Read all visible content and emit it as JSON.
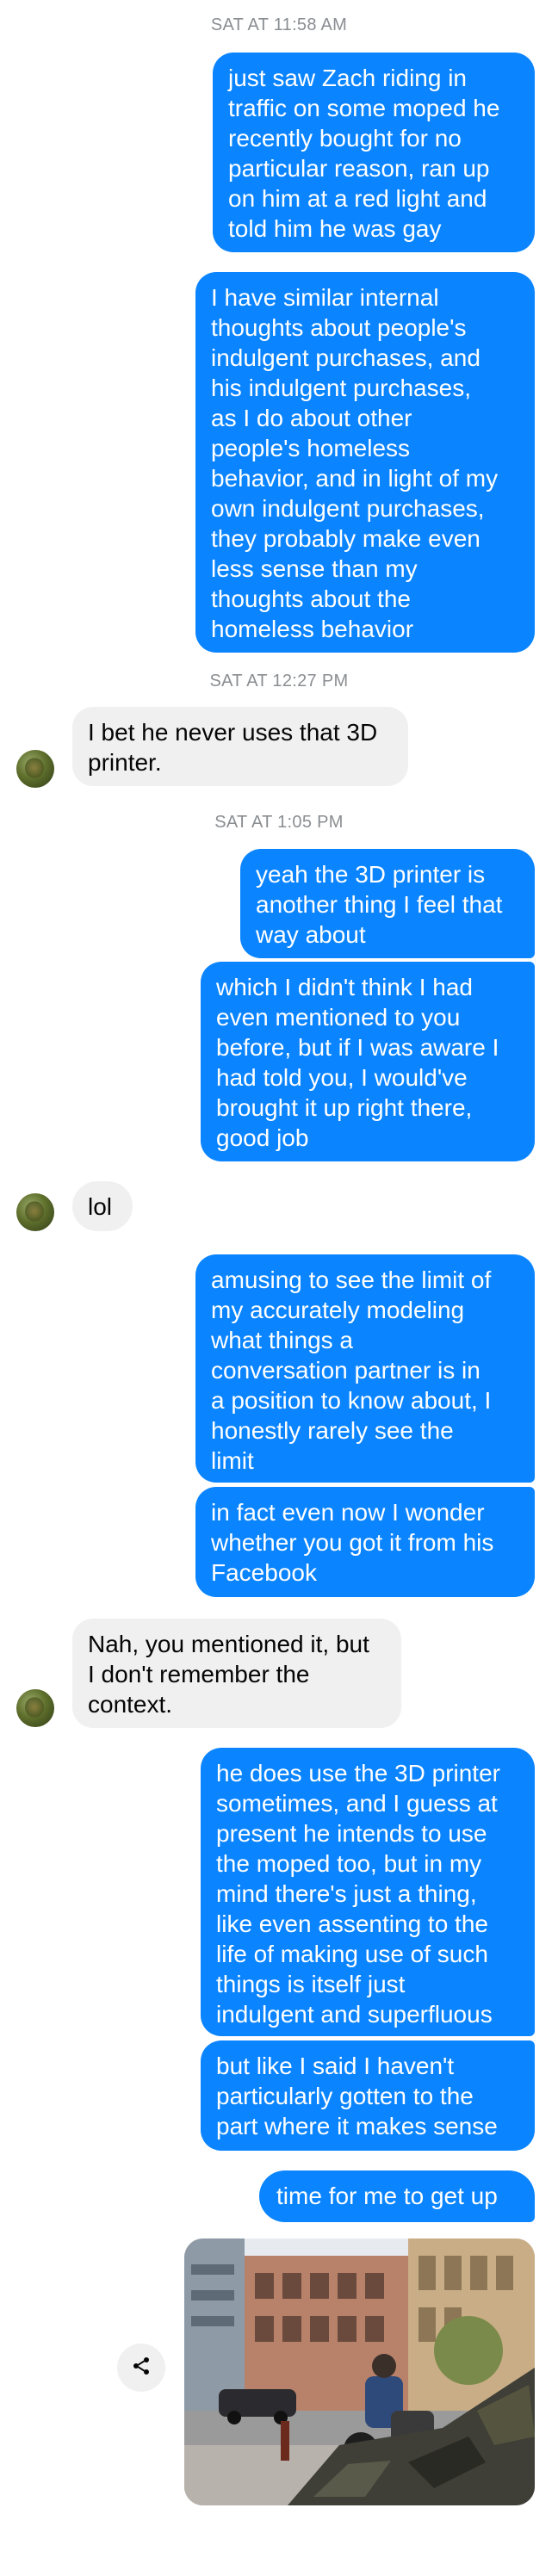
{
  "timestamps": [
    "SAT AT 11:58 AM",
    "SAT AT 12:27 PM",
    "SAT AT 1:05 PM"
  ],
  "messages": [
    {
      "from": "me",
      "text": "just saw Zach riding in\ntraffic on some moped he\nrecently bought for no\nparticular reason, ran up\non him at a red light and\ntold him he was gay"
    },
    {
      "from": "me",
      "text": "I have similar internal\nthoughts about people's\nindulgent purchases, and\nhis indulgent purchases,\nas I do about other\npeople's homeless\nbehavior, and in light of my\nown indulgent purchases,\nthey probably make even\nless sense than my\nthoughts about the\nhomeless behavior"
    },
    {
      "from": "them",
      "text": "I bet he never uses that 3D\nprinter."
    },
    {
      "from": "me",
      "text": "yeah the 3D printer is\nanother thing I feel that\nway about"
    },
    {
      "from": "me",
      "text": "which I didn't think I had\neven mentioned to you\nbefore, but if I was aware I\nhad told you, I would've\nbrought it up right there,\ngood job"
    },
    {
      "from": "them",
      "text": "lol"
    },
    {
      "from": "me",
      "text": "amusing to see the limit of\nmy accurately modeling\nwhat things a\nconversation partner is in\na position to know about, I\nhonestly rarely see the\nlimit"
    },
    {
      "from": "me",
      "text": "in fact even now I wonder\nwhether you got it from his\nFacebook"
    },
    {
      "from": "them",
      "text": "Nah, you mentioned it, but\nI don't remember the\ncontext."
    },
    {
      "from": "me",
      "text": "he does use the 3D printer\nsometimes, and I guess at\npresent he intends to use\nthe moped too, but in my\nmind there's just a thing,\nlike even assenting to the\nlife of making use of such\nthings is itself just\nindulgent and superfluous"
    },
    {
      "from": "me",
      "text": "but like I said I haven't\nparticularly gotten to the\npart where it makes sense"
    },
    {
      "from": "me",
      "text": "time for me to get up"
    }
  ],
  "colors": {
    "outgoing": "#0a84ff",
    "incoming": "#f0f0f0",
    "timestamp": "#8a8d91"
  },
  "icons": {
    "share": "share-icon",
    "avatar": "contact-avatar"
  }
}
